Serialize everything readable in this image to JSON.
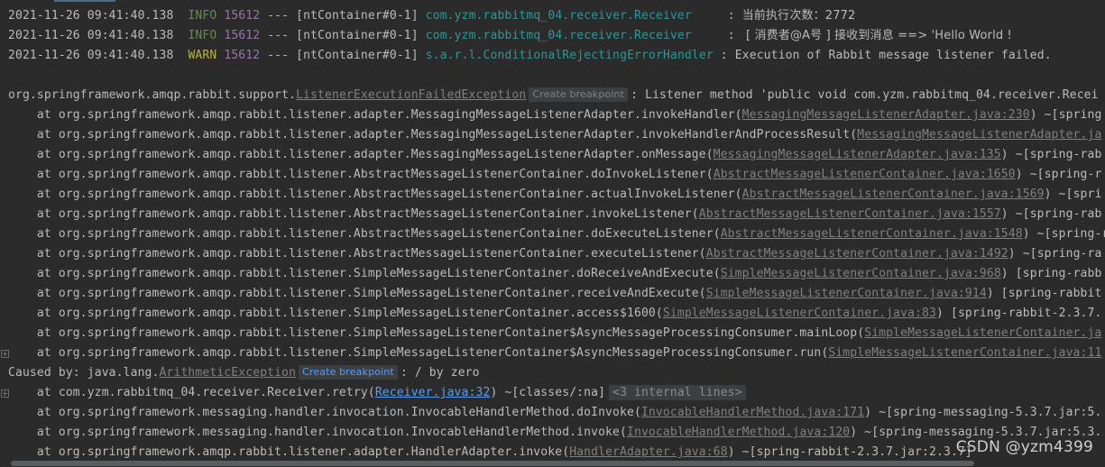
{
  "log_lines": [
    {
      "date": "2021-11-26 09:41:40.138",
      "level": "INFO",
      "pid": "15612",
      "sep": "---",
      "thread": "[ntContainer#0-1]",
      "logger": "com.yzm.rabbitmq_04.receiver.Receiver    ",
      "colon": ":",
      "message": "当前执行次数：2772"
    },
    {
      "date": "2021-11-26 09:41:40.138",
      "level": "INFO",
      "pid": "15612",
      "sep": "---",
      "thread": "[ntContainer#0-1]",
      "logger": "com.yzm.rabbitmq_04.receiver.Receiver    ",
      "colon": ":",
      "message": " [ 消费者@A号 ] 接收到消息 ==> 'Hello World !"
    },
    {
      "date": "2021-11-26 09:41:40.138",
      "level": "WARN",
      "pid": "15612",
      "sep": "---",
      "thread": "[ntContainer#0-1]",
      "logger": "s.a.r.l.ConditionalRejectingErrorHandler",
      "colon": ":",
      "message": "Execution of Rabbit message listener failed."
    }
  ],
  "exception": {
    "prefix": "org.springframework.amqp.rabbit.support.",
    "class_link": "ListenerExecutionFailedException",
    "breakpoint_label": "Create breakpoint",
    "suffix": ": Listener method 'public void com.yzm.rabbitmq_04.receiver.Recei"
  },
  "stack_frames": [
    {
      "method": "    at org.springframework.amqp.rabbit.listener.adapter.MessagingMessageListenerAdapter.invokeHandler(",
      "location": "MessagingMessageListenerAdapter.java:230",
      "tail": ") ~[spring"
    },
    {
      "method": "    at org.springframework.amqp.rabbit.listener.adapter.MessagingMessageListenerAdapter.invokeHandlerAndProcessResult(",
      "location": "MessagingMessageListenerAdapter.ja",
      "tail": ""
    },
    {
      "method": "    at org.springframework.amqp.rabbit.listener.adapter.MessagingMessageListenerAdapter.onMessage(",
      "location": "MessagingMessageListenerAdapter.java:135",
      "tail": ") ~[spring-rab"
    },
    {
      "method": "    at org.springframework.amqp.rabbit.listener.AbstractMessageListenerContainer.doInvokeListener(",
      "location": "AbstractMessageListenerContainer.java:1650",
      "tail": ") ~[spring-r"
    },
    {
      "method": "    at org.springframework.amqp.rabbit.listener.AbstractMessageListenerContainer.actualInvokeListener(",
      "location": "AbstractMessageListenerContainer.java:1569",
      "tail": ") ~[spri"
    },
    {
      "method": "    at org.springframework.amqp.rabbit.listener.AbstractMessageListenerContainer.invokeListener(",
      "location": "AbstractMessageListenerContainer.java:1557",
      "tail": ") ~[spring-rab"
    },
    {
      "method": "    at org.springframework.amqp.rabbit.listener.AbstractMessageListenerContainer.doExecuteListener(",
      "location": "AbstractMessageListenerContainer.java:1548",
      "tail": ") ~[spring-ra"
    },
    {
      "method": "    at org.springframework.amqp.rabbit.listener.AbstractMessageListenerContainer.executeListener(",
      "location": "AbstractMessageListenerContainer.java:1492",
      "tail": ") ~[spring-ra"
    },
    {
      "method": "    at org.springframework.amqp.rabbit.listener.SimpleMessageListenerContainer.doReceiveAndExecute(",
      "location": "SimpleMessageListenerContainer.java:968",
      "tail": ") [spring-rabb"
    },
    {
      "method": "    at org.springframework.amqp.rabbit.listener.SimpleMessageListenerContainer.receiveAndExecute(",
      "location": "SimpleMessageListenerContainer.java:914",
      "tail": ") [spring-rabbit"
    },
    {
      "method": "    at org.springframework.amqp.rabbit.listener.SimpleMessageListenerContainer.access$1600(",
      "location": "SimpleMessageListenerContainer.java:83",
      "tail": ") [spring-rabbit-2.3.7."
    },
    {
      "method": "    at org.springframework.amqp.rabbit.listener.SimpleMessageListenerContainer$AsyncMessageProcessingConsumer.mainLoop(",
      "location": "SimpleMessageListenerContainer.ja",
      "tail": ""
    },
    {
      "method": "    at org.springframework.amqp.rabbit.listener.SimpleMessageListenerContainer$AsyncMessageProcessingConsumer.run(",
      "location": "SimpleMessageListenerContainer.java:11",
      "tail": ""
    }
  ],
  "caused_by": {
    "prefix": "Caused by: java.lang.",
    "class_link": "ArithmeticException",
    "breakpoint_label": "Create breakpoint",
    "suffix": ": / by zero"
  },
  "cause_frames": [
    {
      "method": "    at com.yzm.rabbitmq_04.receiver.Receiver.retry(",
      "location": "Receiver.java:32",
      "tail": ") ~[classes/:na]",
      "fold_label": "<3 internal lines>"
    },
    {
      "method": "    at org.springframework.messaging.handler.invocation.InvocableHandlerMethod.doInvoke(",
      "location": "InvocableHandlerMethod.java:171",
      "tail": ") ~[spring-messaging-5.3.7.jar:5."
    },
    {
      "method": "    at org.springframework.messaging.handler.invocation.InvocableHandlerMethod.invoke(",
      "location": "InvocableHandlerMethod.java:120",
      "tail": ") ~[spring-messaging-5.3.7.jar:5.3."
    },
    {
      "method": "    at org.springframework.amqp.rabbit.listener.adapter.HandlerAdapter.invoke(",
      "location": "HandlerAdapter.java:68",
      "tail": ") ~[spring-rabbit-2.3.7.jar:2.3.7]"
    }
  ],
  "watermark": "CSDN @yzm4399",
  "colors": {
    "background": "#2b2b2b",
    "info": "#6a8759",
    "warn": "#bbb529",
    "pid": "#9876aa",
    "logger": "#299999",
    "link_blue": "#589df6"
  }
}
